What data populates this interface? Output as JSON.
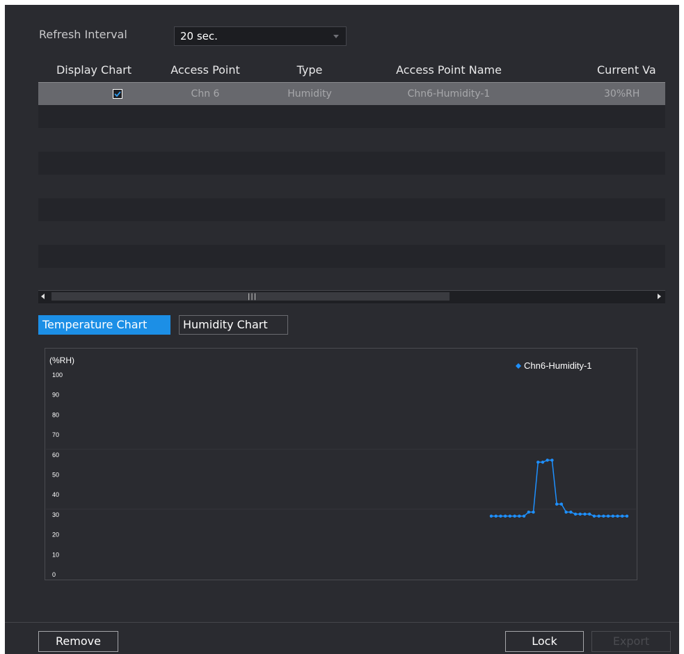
{
  "refresh": {
    "label": "Refresh Interval",
    "value": "20 sec."
  },
  "table": {
    "columns": [
      "Display Chart",
      "Access Point",
      "Type",
      "Access Point Name",
      "Current Va"
    ],
    "rows": [
      {
        "display_chart": true,
        "access_point": "Chn 6",
        "type": "Humidity",
        "name": "Chn6-Humidity-1",
        "current_value": "30%RH"
      }
    ]
  },
  "scrollbar": {
    "grip": "|||"
  },
  "tabs": {
    "temperature": "Temperature Chart",
    "humidity": "Humidity Chart",
    "active": "temperature"
  },
  "chart_data": {
    "type": "line",
    "ylabel": "(%RH)",
    "ylim": [
      0,
      100
    ],
    "yticks": [
      0,
      10,
      20,
      30,
      40,
      50,
      60,
      70,
      80,
      90,
      100
    ],
    "grid": "horizontal at 30 and 60 (faint)",
    "legend_position": "top-right",
    "series": [
      {
        "name": "Chn6-Humidity-1",
        "color": "#1e90ff",
        "values": [
          29,
          29,
          29,
          29,
          29,
          29,
          29,
          29,
          31,
          31,
          56,
          56,
          57,
          57,
          35,
          35,
          31,
          31,
          30,
          30,
          30,
          30,
          29,
          29,
          29,
          29,
          29,
          29,
          29,
          29
        ]
      }
    ]
  },
  "footer": {
    "remove": "Remove",
    "lock": "Lock",
    "export": "Export"
  }
}
